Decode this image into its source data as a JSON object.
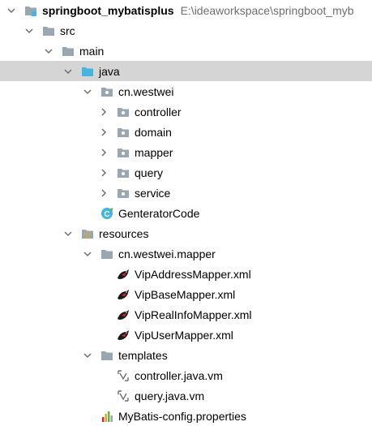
{
  "project": {
    "name": "springboot_mybatisplus",
    "path": "E:\\ideaworkspace\\springboot_myb"
  },
  "tree": {
    "src": "src",
    "main": "main",
    "java": "java",
    "pkg": "cn.westwei",
    "controller": "controller",
    "domain": "domain",
    "mapper": "mapper",
    "query": "query",
    "service": "service",
    "generator": "GenteratorCode",
    "resources": "resources",
    "mapper_pkg": "cn.westwei.mapper",
    "xml1": "VipAddressMapper.xml",
    "xml2": "VipBaseMapper.xml",
    "xml3": "VipRealInfoMapper.xml",
    "xml4": "VipUserMapper.xml",
    "templates": "templates",
    "vm1": "controller.java.vm",
    "vm2": "query.java.vm",
    "props": "MyBatis-config.properties"
  },
  "colors": {
    "selection": "#d5d5d5",
    "folder": "#9aa7b0",
    "source_folder": "#40b6e0",
    "class_icon": "#40b6e0",
    "path_text": "#6e6e6e"
  }
}
